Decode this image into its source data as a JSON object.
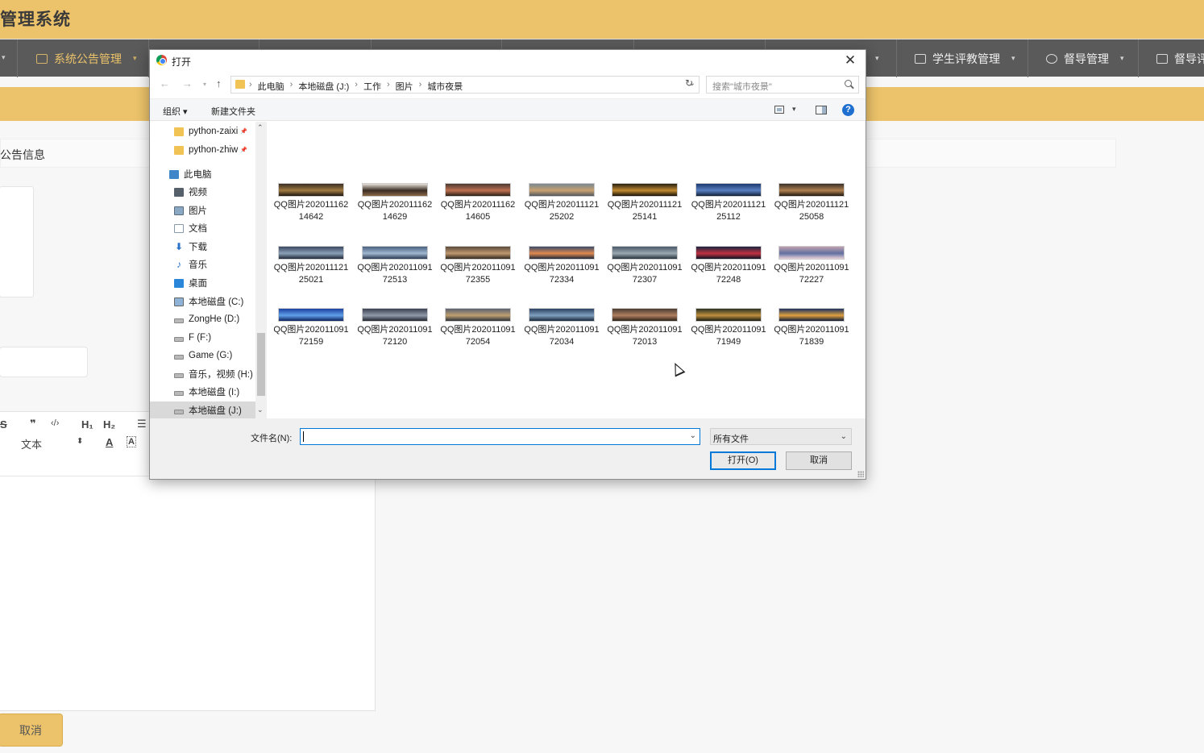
{
  "app": {
    "title": "管理系统",
    "nav": [
      {
        "label": "系统公告管理"
      },
      {
        "label": "学生评教管理"
      },
      {
        "label": "督导管理"
      },
      {
        "label": "督导评"
      }
    ],
    "panel_title": "公告信息",
    "cancel_label": "取消",
    "editor": {
      "quote": "❞",
      "code": "‹/›",
      "h1": "H₁",
      "h2": "H₂",
      "list": "☰",
      "strike": "S",
      "text_style": "文本",
      "font_color": "A",
      "bg_color": "A"
    }
  },
  "dialog": {
    "title": "打开",
    "breadcrumb": [
      "此电脑",
      "本地磁盘 (J:)",
      "工作",
      "图片",
      "城市夜景"
    ],
    "search_placeholder": "搜索\"城市夜景\"",
    "organize_label": "组织 ▾",
    "new_folder_label": "新建文件夹",
    "help_label": "?",
    "nav_items": [
      {
        "label": "python-zaixi",
        "icon": "folder-icon",
        "pinned": true
      },
      {
        "label": "python-zhiw",
        "icon": "folder-icon",
        "pinned": true
      },
      {
        "label": "此电脑",
        "icon": "pc-icon"
      },
      {
        "label": "视频",
        "icon": "video-icon"
      },
      {
        "label": "图片",
        "icon": "pictures-icon"
      },
      {
        "label": "文档",
        "icon": "documents-icon"
      },
      {
        "label": "下载",
        "icon": "download-icon"
      },
      {
        "label": "音乐",
        "icon": "music-icon"
      },
      {
        "label": "桌面",
        "icon": "desktop-icon"
      },
      {
        "label": "本地磁盘 (C:)",
        "icon": "drive-c-icon"
      },
      {
        "label": "ZongHe (D:)",
        "icon": "drive-icon"
      },
      {
        "label": "F (F:)",
        "icon": "drive-icon"
      },
      {
        "label": "Game (G:)",
        "icon": "drive-icon"
      },
      {
        "label": "音乐，视频 (H:)",
        "icon": "drive-icon"
      },
      {
        "label": "本地磁盘 (I:)",
        "icon": "drive-icon"
      },
      {
        "label": "本地磁盘 (J:)",
        "icon": "drive-icon",
        "selected": true
      }
    ],
    "files": [
      {
        "name": "QQ图片20201116214642",
        "colors": [
          "#3a2d22",
          "#a07a40",
          "#1e1612"
        ]
      },
      {
        "name": "QQ图片20201116214629",
        "colors": [
          "#e8e2da",
          "#3a2c22",
          "#8a6a48"
        ]
      },
      {
        "name": "QQ图片20201116214605",
        "colors": [
          "#4a3a30",
          "#c07050",
          "#2a2018"
        ]
      },
      {
        "name": "QQ图片20201112125202",
        "colors": [
          "#7a8a90",
          "#c8a070",
          "#505860"
        ]
      },
      {
        "name": "QQ图片20201112125141",
        "colors": [
          "#2a2010",
          "#c08a30",
          "#181208"
        ]
      },
      {
        "name": "QQ图片20201112125112",
        "colors": [
          "#1c3a70",
          "#5a80c0",
          "#10203a"
        ]
      },
      {
        "name": "QQ图片20201112125058",
        "colors": [
          "#3a3028",
          "#b08050",
          "#20180e"
        ]
      },
      {
        "name": "QQ图片20201112125021",
        "colors": [
          "#3a4860",
          "#8aa0b8",
          "#202838"
        ]
      },
      {
        "name": "QQ图片20201109172513",
        "colors": [
          "#4a6080",
          "#a0b8d0",
          "#2a3850"
        ]
      },
      {
        "name": "QQ图片20201109172355",
        "colors": [
          "#5a4a3a",
          "#c09870",
          "#30281e"
        ]
      },
      {
        "name": "QQ图片20201109172334",
        "colors": [
          "#3a4a6a",
          "#e08a50",
          "#20283a"
        ]
      },
      {
        "name": "QQ图片20201109172307",
        "colors": [
          "#4a5868",
          "#9aa8b0",
          "#28323c"
        ]
      },
      {
        "name": "QQ图片20201109172248",
        "colors": [
          "#1a2440",
          "#c03040",
          "#0e1424"
        ]
      },
      {
        "name": "QQ图片20201109172227",
        "colors": [
          "#c0a0b0",
          "#6070a0",
          "#e8d0d8"
        ]
      },
      {
        "name": "QQ图片20201109172159",
        "colors": [
          "#1a40a0",
          "#60a0e8",
          "#0e2060"
        ]
      },
      {
        "name": "QQ图片20201109172120",
        "colors": [
          "#3a4050",
          "#909aa8",
          "#20242e"
        ]
      },
      {
        "name": "QQ图片20201109172054",
        "colors": [
          "#5a6070",
          "#c0a070",
          "#2a3038"
        ]
      },
      {
        "name": "QQ图片20201109172034",
        "colors": [
          "#2a4060",
          "#80a0c0",
          "#182638"
        ]
      },
      {
        "name": "QQ图片20201109172013",
        "colors": [
          "#4a3a30",
          "#b08060",
          "#2a2018"
        ]
      },
      {
        "name": "QQ图片20201109171949",
        "colors": [
          "#2a3020",
          "#c09040",
          "#181c10"
        ]
      },
      {
        "name": "QQ图片20201109171839",
        "colors": [
          "#1a3060",
          "#e0a040",
          "#0e1a38"
        ]
      }
    ],
    "filename_label": "文件名(N):",
    "filename_value": "",
    "filetype_value": "所有文件",
    "open_label": "打开(O)",
    "cancel_label": "取消"
  }
}
